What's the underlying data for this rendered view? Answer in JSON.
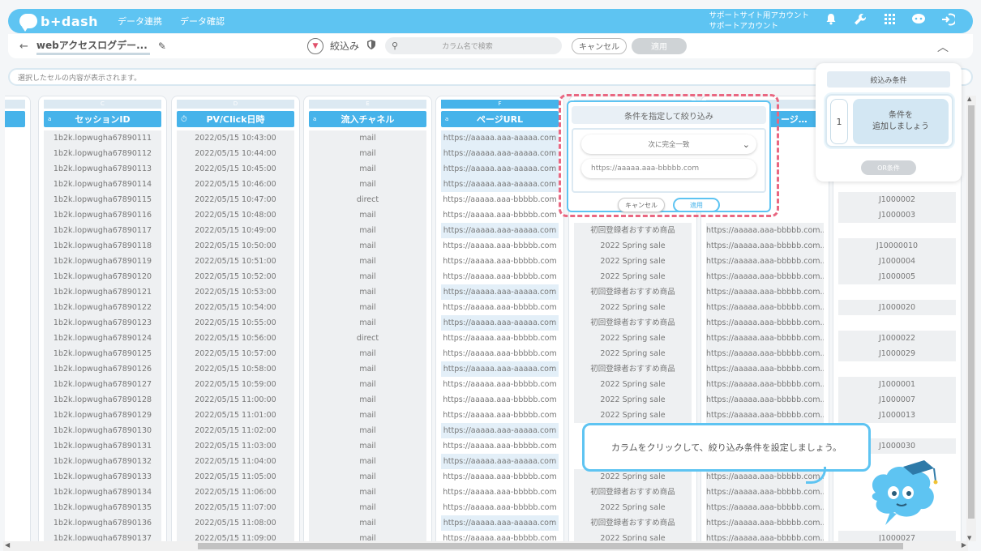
{
  "header": {
    "logo": "b+dash",
    "nav": [
      "データ連携",
      "データ確認"
    ],
    "support": [
      "サポートサイト用アカウント",
      "サポートアカウント"
    ]
  },
  "toolbar": {
    "title": "webアクセスログデー...",
    "filter_label": "絞込み",
    "search_placeholder": "カラム名で検索",
    "cancel_label": "キャンセル",
    "apply_label": "適用"
  },
  "cellbar": {
    "placeholder": "選択したセルの内容が表示されます。"
  },
  "columns": {
    "c": {
      "letter": "C",
      "type_icon": "a",
      "name": "セッションID"
    },
    "d": {
      "letter": "D",
      "type_icon": "⏱",
      "name": "PV/Click日時"
    },
    "e": {
      "letter": "E",
      "type_icon": "a",
      "name": "流入チャネル"
    },
    "f": {
      "letter": "F",
      "type_icon": "a",
      "name": "ページURL"
    },
    "h": {
      "name": "ージ…"
    }
  },
  "rows": [
    {
      "sid": "1b2k.lopwugha67890111",
      "dt": "2022/05/15 10:43:00",
      "ch": "mail",
      "url": "https://aaaaa.aaa-aaaaa.com",
      "g": "",
      "h": "",
      "i": ""
    },
    {
      "sid": "1b2k.lopwugha67890112",
      "dt": "2022/05/15 10:44:00",
      "ch": "mail",
      "url": "https://aaaaa.aaa-aaaaa.com",
      "g": "",
      "h": "",
      "i": ""
    },
    {
      "sid": "1b2k.lopwugha67890113",
      "dt": "2022/05/15 10:45:00",
      "ch": "mail",
      "url": "https://aaaaa.aaa-aaaaa.com",
      "g": "",
      "h": "",
      "i": ""
    },
    {
      "sid": "1b2k.lopwugha67890114",
      "dt": "2022/05/15 10:46:00",
      "ch": "mail",
      "url": "https://aaaaa.aaa-aaaaa.com",
      "g": "",
      "h": "",
      "i": ""
    },
    {
      "sid": "1b2k.lopwugha67890115",
      "dt": "2022/05/15 10:47:00",
      "ch": "direct",
      "url": "https://aaaaa.aaa-bbbbb.com",
      "g": "",
      "h": "",
      "i": "J1000002"
    },
    {
      "sid": "1b2k.lopwugha67890116",
      "dt": "2022/05/15 10:48:00",
      "ch": "mail",
      "url": "https://aaaaa.aaa-bbbbb.com",
      "g": "",
      "h": "",
      "i": "J1000003"
    },
    {
      "sid": "1b2k.lopwugha67890117",
      "dt": "2022/05/15 10:49:00",
      "ch": "mail",
      "url": "https://aaaaa.aaa-aaaaa.com",
      "g": "初回登録者おすすめ商品",
      "h": "https://aaaaa.aaa-bbbbb.com...",
      "i": ""
    },
    {
      "sid": "1b2k.lopwugha67890118",
      "dt": "2022/05/15 10:50:00",
      "ch": "mail",
      "url": "https://aaaaa.aaa-bbbbb.com",
      "g": "2022 Spring sale",
      "h": "https://aaaaa.aaa-bbbbb.com...",
      "i": "J10000010"
    },
    {
      "sid": "1b2k.lopwugha67890119",
      "dt": "2022/05/15 10:51:00",
      "ch": "mail",
      "url": "https://aaaaa.aaa-bbbbb.com",
      "g": "2022 Spring sale",
      "h": "https://aaaaa.aaa-bbbbb.com...",
      "i": "J1000004"
    },
    {
      "sid": "1b2k.lopwugha67890120",
      "dt": "2022/05/15 10:52:00",
      "ch": "mail",
      "url": "https://aaaaa.aaa-bbbbb.com",
      "g": "2022 Spring sale",
      "h": "https://aaaaa.aaa-bbbbb.com...",
      "i": "J1000005"
    },
    {
      "sid": "1b2k.lopwugha67890121",
      "dt": "2022/05/15 10:53:00",
      "ch": "mail",
      "url": "https://aaaaa.aaa-aaaaa.com",
      "g": "初回登録者おすすめ商品",
      "h": "https://aaaaa.aaa-bbbbb.com...",
      "i": ""
    },
    {
      "sid": "1b2k.lopwugha67890122",
      "dt": "2022/05/15 10:54:00",
      "ch": "mail",
      "url": "https://aaaaa.aaa-bbbbb.com",
      "g": "2022 Spring sale",
      "h": "https://aaaaa.aaa-bbbbb.com...",
      "i": "J1000020"
    },
    {
      "sid": "1b2k.lopwugha67890123",
      "dt": "2022/05/15 10:55:00",
      "ch": "mail",
      "url": "https://aaaaa.aaa-aaaaa.com",
      "g": "初回登録者おすすめ商品",
      "h": "https://aaaaa.aaa-bbbbb.com...",
      "i": ""
    },
    {
      "sid": "1b2k.lopwugha67890124",
      "dt": "2022/05/15 10:56:00",
      "ch": "direct",
      "url": "https://aaaaa.aaa-bbbbb.com",
      "g": "2022 Spring sale",
      "h": "https://aaaaa.aaa-bbbbb.com...",
      "i": "J1000022"
    },
    {
      "sid": "1b2k.lopwugha67890125",
      "dt": "2022/05/15 10:57:00",
      "ch": "mail",
      "url": "https://aaaaa.aaa-bbbbb.com",
      "g": "2022 Spring sale",
      "h": "https://aaaaa.aaa-bbbbb.com...",
      "i": "J1000029"
    },
    {
      "sid": "1b2k.lopwugha67890126",
      "dt": "2022/05/15 10:58:00",
      "ch": "mail",
      "url": "https://aaaaa.aaa-aaaaa.com",
      "g": "初回登録者おすすめ商品",
      "h": "https://aaaaa.aaa-bbbbb.com...",
      "i": ""
    },
    {
      "sid": "1b2k.lopwugha67890127",
      "dt": "2022/05/15 10:59:00",
      "ch": "mail",
      "url": "https://aaaaa.aaa-bbbbb.com",
      "g": "2022 Spring sale",
      "h": "https://aaaaa.aaa-bbbbb.com...",
      "i": "J1000001"
    },
    {
      "sid": "1b2k.lopwugha67890128",
      "dt": "2022/05/15 11:00:00",
      "ch": "mail",
      "url": "https://aaaaa.aaa-bbbbb.com",
      "g": "2022 Spring sale",
      "h": "https://aaaaa.aaa-bbbbb.com...",
      "i": "J1000007"
    },
    {
      "sid": "1b2k.lopwugha67890129",
      "dt": "2022/05/15 11:01:00",
      "ch": "mail",
      "url": "https://aaaaa.aaa-bbbbb.com",
      "g": "2022 Spring sale",
      "h": "https://aaaaa.aaa-bbbbb.com...",
      "i": "J1000013"
    },
    {
      "sid": "1b2k.lopwugha67890130",
      "dt": "2022/05/15 11:02:00",
      "ch": "mail",
      "url": "https://aaaaa.aaa-aaaaa.com",
      "g": "",
      "h": "",
      "i": ""
    },
    {
      "sid": "1b2k.lopwugha67890131",
      "dt": "2022/05/15 11:03:00",
      "ch": "mail",
      "url": "https://aaaaa.aaa-bbbbb.com",
      "g": "",
      "h": "",
      "i": "J1000030"
    },
    {
      "sid": "1b2k.lopwugha67890132",
      "dt": "2022/05/15 11:04:00",
      "ch": "mail",
      "url": "https://aaaaa.aaa-aaaaa.com",
      "g": "",
      "h": "",
      "i": ""
    },
    {
      "sid": "1b2k.lopwugha67890133",
      "dt": "2022/05/15 11:05:00",
      "ch": "mail",
      "url": "https://aaaaa.aaa-bbbbb.com",
      "g": "2022 Spring sale",
      "h": "https://aaaaa.aaa-bbbbb.com...",
      "i": ""
    },
    {
      "sid": "1b2k.lopwugha67890134",
      "dt": "2022/05/15 11:06:00",
      "ch": "mail",
      "url": "https://aaaaa.aaa-bbbbb.com",
      "g": "初回登録者おすすめ商品",
      "h": "https://aaaaa.aaa-bbbbb.com...",
      "i": ""
    },
    {
      "sid": "1b2k.lopwugha67890135",
      "dt": "2022/05/15 11:07:00",
      "ch": "mail",
      "url": "https://aaaaa.aaa-bbbbb.com",
      "g": "2022 Spring sale",
      "h": "https://aaaaa.aaa-bbbbb.com...",
      "i": ""
    },
    {
      "sid": "1b2k.lopwugha67890136",
      "dt": "2022/05/15 11:08:00",
      "ch": "mail",
      "url": "https://aaaaa.aaa-aaaaa.com",
      "g": "初回登録者おすすめ商品",
      "h": "https://aaaaa.aaa-bbbbb.com...",
      "i": ""
    },
    {
      "sid": "1b2k.lopwugha67890137",
      "dt": "2022/05/15 11:09:00",
      "ch": "mail",
      "url": "https://aaaaa.aaa-bbbbb.com",
      "g": "2022 Spring sale",
      "h": "https://aaaaa.aaa-bbbbb.com...",
      "i": "J1000027"
    }
  ],
  "popover": {
    "title": "条件を指定して絞り込み",
    "operator": "次に完全一致",
    "value": "https://aaaaa.aaa-bbbbb.com",
    "cancel_label": "キャンセル",
    "apply_label": "適用"
  },
  "conditions": {
    "title": "絞込み条件",
    "number": "1",
    "add_line1": "条件を",
    "add_line2": "追加しましょう",
    "or_label": "OR条件"
  },
  "tooltip": {
    "text": "カラムをクリックして、絞り込み条件を設定しましょう。"
  },
  "colors": {
    "accent": "#5ec4f2",
    "header_col": "#46b3ea",
    "highlight_border": "#e96781"
  }
}
